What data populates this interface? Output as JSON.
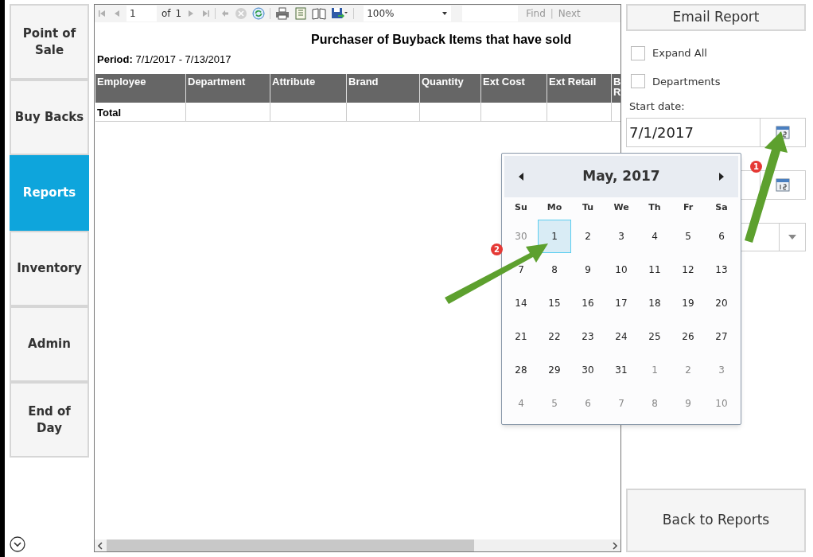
{
  "nav": [
    {
      "label": "Point of Sale",
      "selected": false
    },
    {
      "label": "Buy Backs",
      "selected": false
    },
    {
      "label": "Reports",
      "selected": true
    },
    {
      "label": "Inventory",
      "selected": false
    },
    {
      "label": "Admin",
      "selected": false
    },
    {
      "label": "End of Day",
      "selected": false
    }
  ],
  "toolbar": {
    "page": "1",
    "of": "of",
    "total": "1",
    "zoom": "100%",
    "find": "Find",
    "separator": "|",
    "next": "Next"
  },
  "report": {
    "title": "Purchaser of Buyback Items that have sold",
    "period_label": "Period:",
    "period": "7/1/2017 - 7/13/2017",
    "columns": [
      "Employee",
      "Department",
      "Attribute",
      "Brand",
      "Quantity",
      "Ext Cost",
      "Ext Retail",
      "B R"
    ],
    "total_label": "Total"
  },
  "panel": {
    "email_button": "Email Report",
    "checkboxes": [
      {
        "label": "Expand All",
        "checked": false
      },
      {
        "label": "Departments",
        "checked": false
      }
    ],
    "start_label": "Start date:",
    "start_value": "7/1/2017",
    "back_button": "Back to Reports"
  },
  "calendar": {
    "title": "May, 2017",
    "weekdays": [
      "Su",
      "Mo",
      "Tu",
      "We",
      "Th",
      "Fr",
      "Sa"
    ],
    "days": [
      {
        "label": "30",
        "in_month": false,
        "selected": false
      },
      {
        "label": "1",
        "in_month": true,
        "selected": true
      },
      {
        "label": "2",
        "in_month": true,
        "selected": false
      },
      {
        "label": "3",
        "in_month": true,
        "selected": false
      },
      {
        "label": "4",
        "in_month": true,
        "selected": false
      },
      {
        "label": "5",
        "in_month": true,
        "selected": false
      },
      {
        "label": "6",
        "in_month": true,
        "selected": false
      },
      {
        "label": "7",
        "in_month": true,
        "selected": false
      },
      {
        "label": "8",
        "in_month": true,
        "selected": false
      },
      {
        "label": "9",
        "in_month": true,
        "selected": false
      },
      {
        "label": "10",
        "in_month": true,
        "selected": false
      },
      {
        "label": "11",
        "in_month": true,
        "selected": false
      },
      {
        "label": "12",
        "in_month": true,
        "selected": false
      },
      {
        "label": "13",
        "in_month": true,
        "selected": false
      },
      {
        "label": "14",
        "in_month": true,
        "selected": false
      },
      {
        "label": "15",
        "in_month": true,
        "selected": false
      },
      {
        "label": "16",
        "in_month": true,
        "selected": false
      },
      {
        "label": "17",
        "in_month": true,
        "selected": false
      },
      {
        "label": "18",
        "in_month": true,
        "selected": false
      },
      {
        "label": "19",
        "in_month": true,
        "selected": false
      },
      {
        "label": "20",
        "in_month": true,
        "selected": false
      },
      {
        "label": "21",
        "in_month": true,
        "selected": false
      },
      {
        "label": "22",
        "in_month": true,
        "selected": false
      },
      {
        "label": "23",
        "in_month": true,
        "selected": false
      },
      {
        "label": "24",
        "in_month": true,
        "selected": false
      },
      {
        "label": "25",
        "in_month": true,
        "selected": false
      },
      {
        "label": "26",
        "in_month": true,
        "selected": false
      },
      {
        "label": "27",
        "in_month": true,
        "selected": false
      },
      {
        "label": "28",
        "in_month": true,
        "selected": false
      },
      {
        "label": "29",
        "in_month": true,
        "selected": false
      },
      {
        "label": "30",
        "in_month": true,
        "selected": false
      },
      {
        "label": "31",
        "in_month": true,
        "selected": false
      },
      {
        "label": "1",
        "in_month": false,
        "selected": false
      },
      {
        "label": "2",
        "in_month": false,
        "selected": false
      },
      {
        "label": "3",
        "in_month": false,
        "selected": false
      },
      {
        "label": "4",
        "in_month": false,
        "selected": false
      },
      {
        "label": "5",
        "in_month": false,
        "selected": false
      },
      {
        "label": "6",
        "in_month": false,
        "selected": false
      },
      {
        "label": "7",
        "in_month": false,
        "selected": false
      },
      {
        "label": "8",
        "in_month": false,
        "selected": false
      },
      {
        "label": "9",
        "in_month": false,
        "selected": false
      },
      {
        "label": "10",
        "in_month": false,
        "selected": false
      }
    ]
  },
  "annotations": [
    {
      "label": "1"
    },
    {
      "label": "2"
    }
  ]
}
